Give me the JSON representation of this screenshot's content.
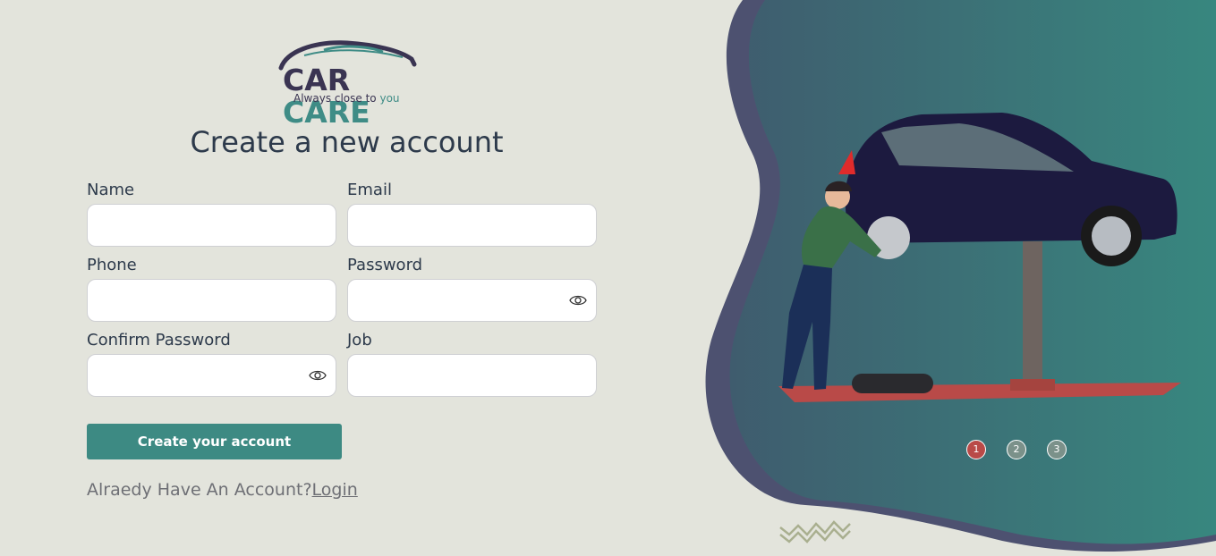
{
  "logo": {
    "brand_part1": "CAR",
    "brand_part2": "CARE",
    "tagline_part1": "Always close to ",
    "tagline_part2": "you"
  },
  "page_title": "Create a new account",
  "form": {
    "name_label": "Name",
    "email_label": "Email",
    "phone_label": "Phone",
    "password_label": "Password",
    "confirm_password_label": "Confirm Password",
    "job_label": "Job",
    "submit_label": "Create your account"
  },
  "login": {
    "prompt": "Alraedy Have An Account?",
    "link": "Login"
  },
  "carousel": {
    "dots": [
      "1",
      "2",
      "3"
    ],
    "active_index": 0
  },
  "colors": {
    "background": "#e3e4dc",
    "accent": "#3d8a83",
    "active_dot": "#b94a48",
    "inactive_dot": "#7b918a"
  },
  "icons": {
    "password_toggle": "eye-icon"
  }
}
